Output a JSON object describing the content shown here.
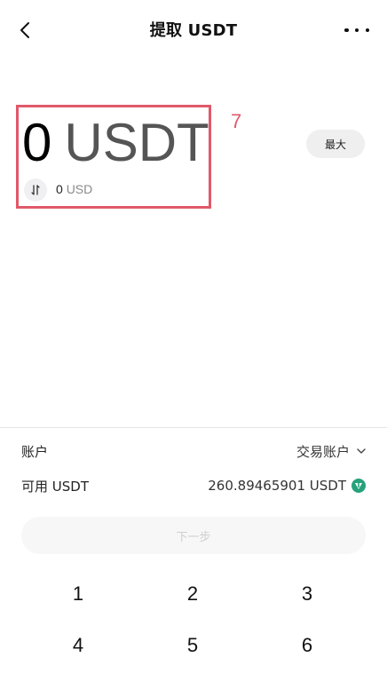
{
  "header": {
    "title": "提取 USDT"
  },
  "amount": {
    "value": "0",
    "unit": "USDT",
    "converted_value": "0",
    "converted_unit": "USD"
  },
  "annotation": "7",
  "max_button_label": "最大",
  "account": {
    "label": "账户",
    "value": "交易账户"
  },
  "available": {
    "label": "可用 USDT",
    "value": "260.89465901 USDT"
  },
  "next_button_label": "下一步",
  "keypad": [
    "1",
    "2",
    "3",
    "4",
    "5",
    "6"
  ],
  "colors": {
    "highlight_border": "#e0596a",
    "tether_green": "#26a17b"
  }
}
